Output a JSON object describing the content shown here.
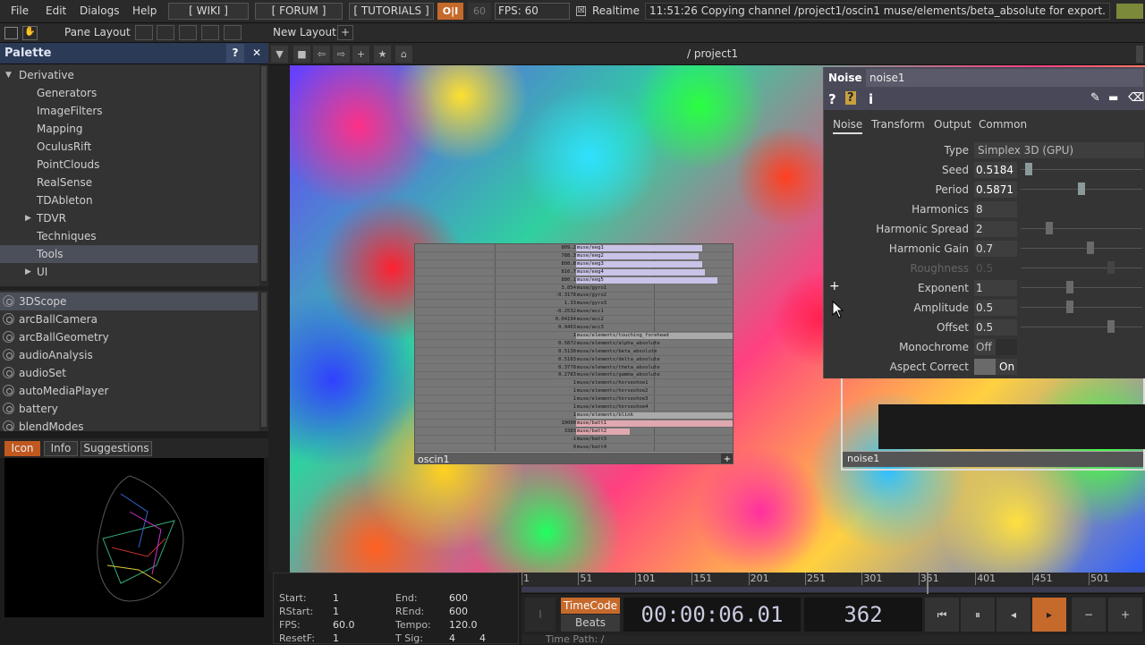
{
  "menu": {
    "file": "File",
    "edit": "Edit",
    "dialogs": "Dialogs",
    "help": "Help",
    "wiki": "[ WIKI ]",
    "forum": "[ FORUM ]",
    "tutorials": "[ TUTORIALS ]",
    "oi": "O|I",
    "fps_field": "60",
    "fps_label": "FPS:  60",
    "realtime_check": "☒",
    "realtime": "Realtime",
    "status": "11:51:26 Copying channel /project1/oscin1 muse/elements/beta_absolute for export."
  },
  "toolbar2": {
    "pane_layout": "Pane Layout",
    "new_layout": "New Layout",
    "plus": "+"
  },
  "palette": {
    "title": "Palette",
    "help": "?",
    "close": "✕",
    "tree": [
      {
        "label": "Derivative",
        "type": "open"
      },
      {
        "label": "Generators"
      },
      {
        "label": "ImageFilters"
      },
      {
        "label": "Mapping"
      },
      {
        "label": "OculusRift"
      },
      {
        "label": "PointClouds"
      },
      {
        "label": "RealSense"
      },
      {
        "label": "TDAbleton"
      },
      {
        "label": "TDVR",
        "type": "closed"
      },
      {
        "label": "Techniques"
      },
      {
        "label": "Tools",
        "selected": true
      },
      {
        "label": "UI",
        "type": "closed"
      }
    ],
    "components": [
      "3DScope",
      "arcBallCamera",
      "arcBallGeometry",
      "audioAnalysis",
      "audioSet",
      "autoMediaPlayer",
      "battery",
      "blendModes"
    ],
    "tabs": {
      "icon": "Icon",
      "info": "Info",
      "suggestions": "Suggestions"
    }
  },
  "network": {
    "path": "/ project1"
  },
  "oscin": {
    "name": "oscin1",
    "plus": "+",
    "rows": [
      {
        "v": "809.2",
        "n": "muse/eeg1",
        "w": 0.8
      },
      {
        "v": "788.3",
        "n": "muse/eeg2",
        "w": 0.78
      },
      {
        "v": "808.8",
        "n": "muse/eeg3",
        "w": 0.8
      },
      {
        "v": "816.7",
        "n": "muse/eeg4",
        "w": 0.82
      },
      {
        "v": "880.1",
        "n": "muse/eeg5",
        "w": 0.9
      },
      {
        "v": "3.854",
        "n": "muse/gyro1",
        "w": 0
      },
      {
        "v": "-0.3178",
        "n": "muse/gyro2",
        "w": 0
      },
      {
        "v": "1.33",
        "n": "muse/gyro3",
        "w": 0
      },
      {
        "v": "-0.2532",
        "n": "muse/acc1",
        "w": 0
      },
      {
        "v": "0.04194",
        "n": "muse/acc2",
        "w": 0
      },
      {
        "v": "0.9463",
        "n": "muse/acc3",
        "w": 0
      },
      {
        "v": "1",
        "n": "muse/elements/touching_forehead",
        "w": 1
      },
      {
        "v": "0.5872",
        "n": "muse/elements/alpha_absolute",
        "w": 0
      },
      {
        "v": "0.5138",
        "n": "muse/elements/beta_absolute",
        "w": 0
      },
      {
        "v": "0.5183",
        "n": "muse/elements/delta_absolute",
        "w": 0
      },
      {
        "v": "0.3778",
        "n": "muse/elements/theta_absolute",
        "w": 0
      },
      {
        "v": "0.2783",
        "n": "muse/elements/gamma_absolute",
        "w": 0
      },
      {
        "v": "1",
        "n": "muse/elements/horseshoe1",
        "w": 0
      },
      {
        "v": "1",
        "n": "muse/elements/horseshoe2",
        "w": 0
      },
      {
        "v": "1",
        "n": "muse/elements/horseshoe3",
        "w": 0
      },
      {
        "v": "1",
        "n": "muse/elements/horseshoe4",
        "w": 0
      },
      {
        "v": "1",
        "n": "muse/elements/blink",
        "w": 1
      },
      {
        "v": "10000",
        "n": "muse/batt1",
        "w": 1
      },
      {
        "v": "3383",
        "n": "muse/batt2",
        "w": 0.34
      },
      {
        "v": "-1",
        "n": "muse/batt3",
        "w": 0
      },
      {
        "v": "0",
        "n": "muse/batt4",
        "w": 0
      }
    ]
  },
  "noise_node": {
    "name": "noise1"
  },
  "param": {
    "op_type": "Noise",
    "op_name": "noise1",
    "help": "?",
    "python_help": "?",
    "info": "i",
    "tabs": [
      "Noise",
      "Transform",
      "Output",
      "Common"
    ],
    "type_label": "Type",
    "type_value": "Simplex 3D (GPU)",
    "rows": [
      {
        "label": "Seed",
        "value": "0.5184",
        "knob": 0.04,
        "bright": true
      },
      {
        "label": "Period",
        "value": "0.5871",
        "knob": 0.5,
        "bright": true
      },
      {
        "label": "Harmonics",
        "value": "8",
        "knob": -1
      },
      {
        "label": "Harmonic Spread",
        "value": "2",
        "knob": 0.22
      },
      {
        "label": "Harmonic Gain",
        "value": "0.7",
        "knob": 0.58
      },
      {
        "label": "Roughness",
        "value": "0.5",
        "knob": 0.76,
        "dim": true
      },
      {
        "label": "Exponent",
        "value": "1",
        "knob": 0.4
      },
      {
        "label": "Amplitude",
        "value": "0.5",
        "knob": 0.4
      },
      {
        "label": "Offset",
        "value": "0.5",
        "knob": 0.76
      }
    ],
    "monochrome_label": "Monochrome",
    "monochrome": "Off",
    "aspect_label": "Aspect Correct",
    "aspect": "On"
  },
  "timeline": {
    "start_l": "Start:",
    "start": "1",
    "end_l": "End:",
    "end": "600",
    "rstart_l": "RStart:",
    "rstart": "1",
    "rend_l": "REnd:",
    "rend": "600",
    "fps_l": "FPS:",
    "fps": "60.0",
    "tempo_l": "Tempo:",
    "tempo": "120.0",
    "resetf_l": "ResetF:",
    "resetf": "1",
    "tsig_l": "T Sig:",
    "tsig_a": "4",
    "tsig_b": "4",
    "ticks": [
      "1",
      "51",
      "101",
      "151",
      "201",
      "251",
      "301",
      "351",
      "401",
      "451",
      "501"
    ],
    "timecode_btn": "TimeCode",
    "beats_btn": "Beats",
    "timecode": "00:00:06.01",
    "frame": "362",
    "time_path": "Time Path: /"
  }
}
